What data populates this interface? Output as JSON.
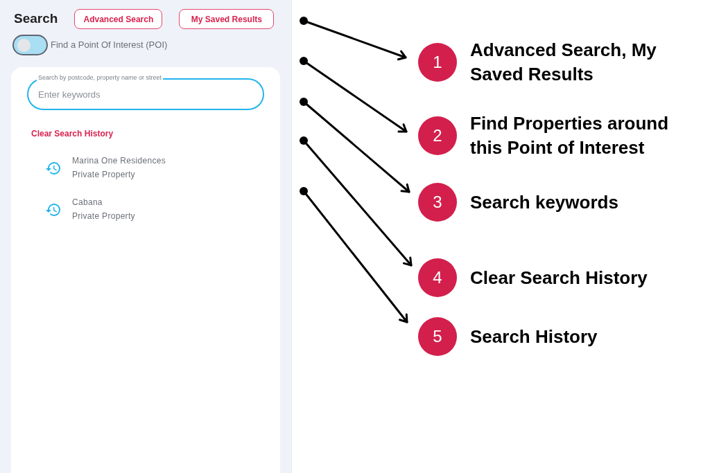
{
  "search_panel": {
    "title": "Search",
    "buttons": [
      "Advanced Search",
      "My Saved Results"
    ],
    "poi_toggle": {
      "label": "Find a Point Of Interest (POI)",
      "on": false
    },
    "search_field": {
      "label": "Search by postcode, property name or street",
      "placeholder": "Enter keywords"
    },
    "clear_history": "Clear Search History",
    "history": [
      {
        "name": "Marina One Residences",
        "category": "Private Property"
      },
      {
        "name": "Cabana",
        "category": "Private Property"
      }
    ]
  },
  "callouts": [
    {
      "number": "1",
      "text": "Advanced Search, My Saved Results"
    },
    {
      "number": "2",
      "text": "Find Properties around this Point of Interest"
    },
    {
      "number": "3",
      "text": "Search keywords"
    },
    {
      "number": "4",
      "text": "Clear Search History"
    },
    {
      "number": "5",
      "text": "Search History"
    }
  ]
}
